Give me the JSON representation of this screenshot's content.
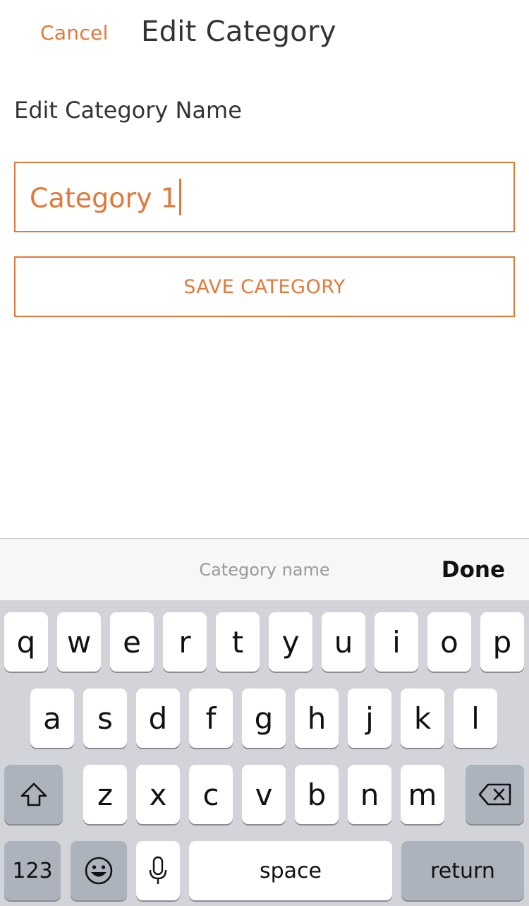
{
  "nav": {
    "cancel_label": "Cancel",
    "title": "Edit Category"
  },
  "form": {
    "section_label": "Edit Category Name",
    "name_value": "Category 1",
    "save_label": "SAVE CATEGORY"
  },
  "keyboard_accessory": {
    "hint": "Category name",
    "done_label": "Done"
  },
  "keyboard": {
    "row1": [
      "q",
      "w",
      "e",
      "r",
      "t",
      "y",
      "u",
      "i",
      "o",
      "p"
    ],
    "row2": [
      "a",
      "s",
      "d",
      "f",
      "g",
      "h",
      "j",
      "k",
      "l"
    ],
    "row3": [
      "z",
      "x",
      "c",
      "v",
      "b",
      "n",
      "m"
    ],
    "numbers_label": "123",
    "space_label": "space",
    "return_label": "return",
    "icons": {
      "shift": "shift-icon",
      "delete": "backspace-icon",
      "emoji": "emoji-icon",
      "mic": "microphone-icon"
    }
  },
  "colors": {
    "accent": "#e2793a",
    "text": "#333333",
    "keyboard_bg": "#d2d4da",
    "dark_key": "#adb3bc"
  }
}
